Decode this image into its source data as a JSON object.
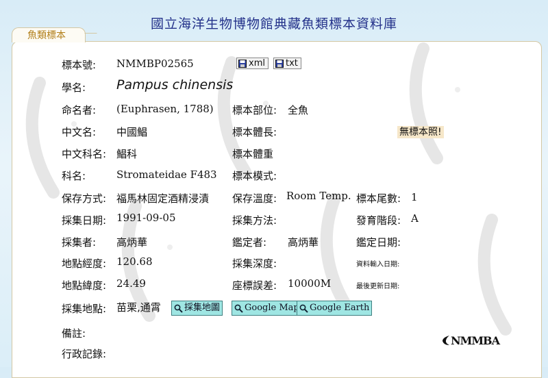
{
  "site_title": "國立海洋生物博物館典藏魚類標本資料庫",
  "tab_label": "魚類標本",
  "record": {
    "specimen_no_label": "標本號:",
    "specimen_no": "NMMBP02565",
    "xml_label": "xml",
    "txt_label": "txt",
    "sci_name_label": "學名:",
    "sci_name": "Pampus chinensis",
    "author_label": "命名者:",
    "author": "(Euphrasen, 1788)",
    "part_label": "標本部位:",
    "part": "全魚",
    "chinese_name_label": "中文名:",
    "chinese_name": "中國鯧",
    "length_label": "標本體長:",
    "no_photo": "無標本照!",
    "family_cn_label": "中文科名:",
    "family_cn": "鯧科",
    "weight_label": "標本體重",
    "family_label": "科名:",
    "family": "Stromateidae  F483",
    "type_label": "標本模式:",
    "preservation_label": "保存方式:",
    "preservation": "福馬林固定酒精浸漬",
    "temp_label": "保存溫度:",
    "temp": "Room Temp.",
    "tail_count_label": "標本尾數:",
    "tail_count": "1",
    "collect_date_label": "採集日期:",
    "collect_date": "1991-09-05",
    "collect_method_label": "採集方法:",
    "stage_label": "發育階段:",
    "stage": "A",
    "collector_label": "採集者:",
    "collector": "高炳華",
    "identifier_label": "鑑定者:",
    "identifier": "高炳華",
    "identify_date_label": "鑑定日期:",
    "longitude_label": "地點經度:",
    "longitude": "120.68",
    "depth_label": "採集深度:",
    "entry_date_label": "資料輸入日期:",
    "latitude_label": "地點緯度:",
    "latitude": "24.49",
    "coord_error_label": "座標誤差:",
    "coord_error": "10000M",
    "update_date_label": "最後更新日期:",
    "locality_label": "採集地點:",
    "locality": "苗栗,通霄",
    "map_btn": "採集地圖",
    "google_map_btn": "Google Map",
    "google_earth_btn": "Google Earth",
    "remarks_label": "備註:",
    "admin_label": "行政記錄:"
  },
  "logo_text": "NMMBA",
  "colors": {
    "title": "#23318a",
    "tab_text": "#b27f19",
    "map_button": "#9fe6e3",
    "no_photo_bg": "#f6e7c9"
  }
}
